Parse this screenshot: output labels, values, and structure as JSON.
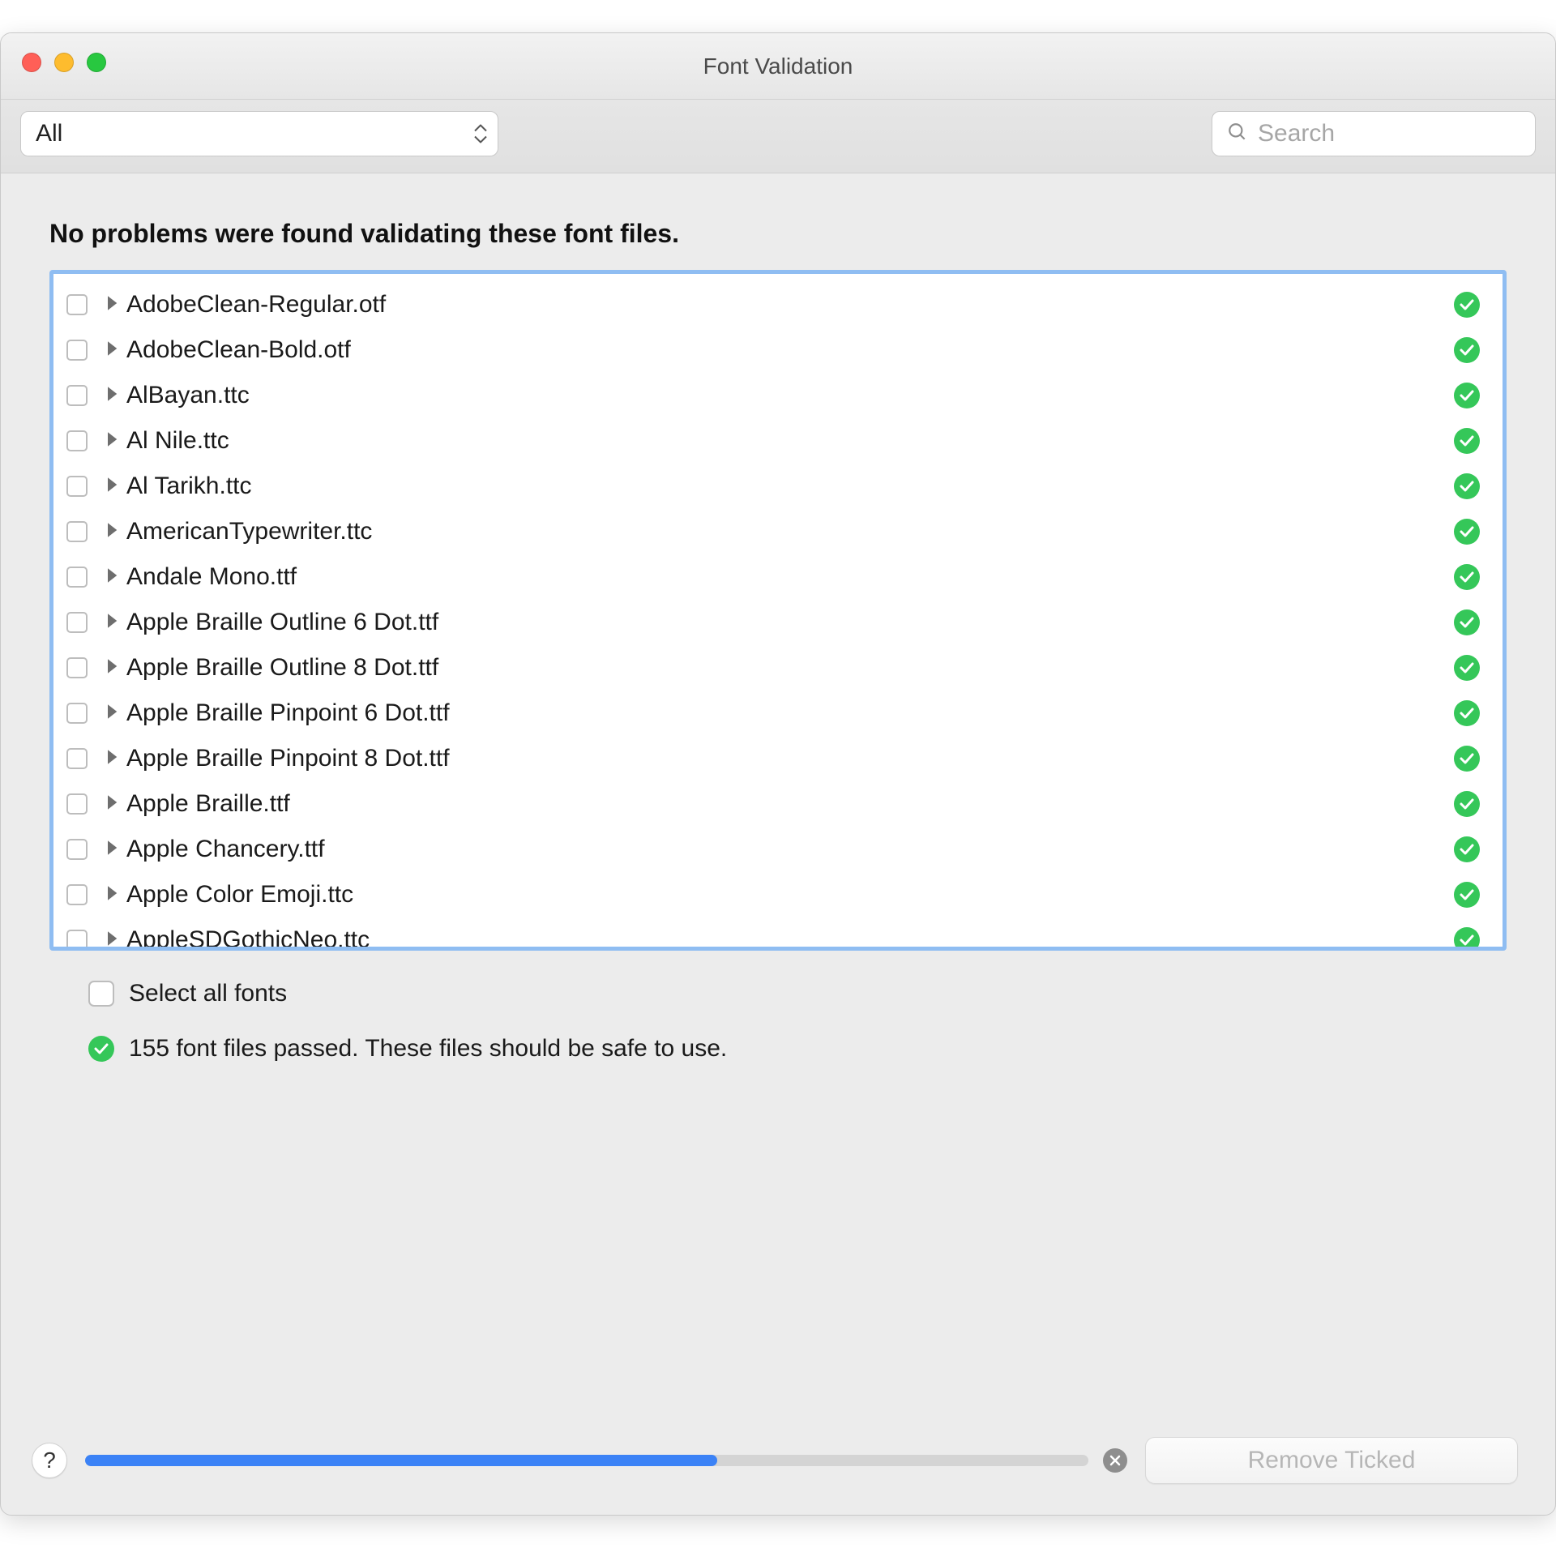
{
  "window": {
    "title": "Font Validation"
  },
  "toolbar": {
    "filter_value": "All",
    "search_placeholder": "Search"
  },
  "main": {
    "heading": "No problems were found validating these font files.",
    "fonts": [
      {
        "name": "AdobeClean-Regular.otf",
        "status": "ok"
      },
      {
        "name": "AdobeClean-Bold.otf",
        "status": "ok"
      },
      {
        "name": "AlBayan.ttc",
        "status": "ok"
      },
      {
        "name": "Al Nile.ttc",
        "status": "ok"
      },
      {
        "name": "Al Tarikh.ttc",
        "status": "ok"
      },
      {
        "name": "AmericanTypewriter.ttc",
        "status": "ok"
      },
      {
        "name": "Andale Mono.ttf",
        "status": "ok"
      },
      {
        "name": "Apple Braille Outline 6 Dot.ttf",
        "status": "ok"
      },
      {
        "name": "Apple Braille Outline 8 Dot.ttf",
        "status": "ok"
      },
      {
        "name": "Apple Braille Pinpoint 6 Dot.ttf",
        "status": "ok"
      },
      {
        "name": "Apple Braille Pinpoint 8 Dot.ttf",
        "status": "ok"
      },
      {
        "name": "Apple Braille.ttf",
        "status": "ok"
      },
      {
        "name": "Apple Chancery.ttf",
        "status": "ok"
      },
      {
        "name": "Apple Color Emoji.ttc",
        "status": "ok"
      },
      {
        "name": "AppleSDGothicNeo.ttc",
        "status": "ok"
      }
    ],
    "select_all_label": "Select all fonts",
    "summary": "155 font files passed. These files should be safe to use.",
    "passed_count": 155
  },
  "footer": {
    "help_label": "?",
    "progress_percent": 63,
    "remove_label": "Remove Ticked",
    "remove_enabled": false
  }
}
